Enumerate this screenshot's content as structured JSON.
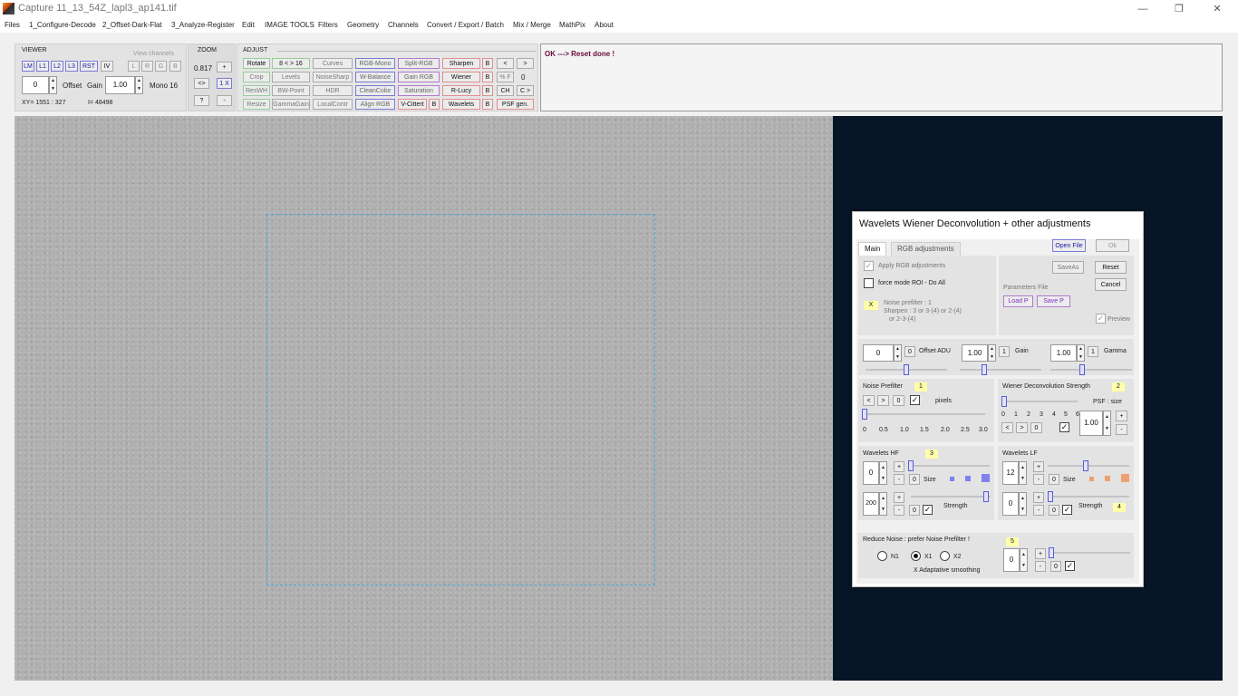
{
  "window": {
    "title": "Capture 11_13_54Z_lapl3_ap141.tif",
    "minimize": "—",
    "maximize": "❐",
    "close": "✕"
  },
  "menu": [
    "Files",
    "1_Configure-Decode",
    "2_Offset-Dark-Flat",
    "3_Analyze-Register",
    "Edit",
    "IMAGE TOOLS",
    "Filters",
    "Geometry",
    "Channels",
    "Convert / Export / Batch",
    "Mix / Merge",
    "MathPix",
    "About"
  ],
  "viewer": {
    "title": "VIEWER",
    "view_channels": "View channels",
    "buttons": [
      "LM",
      "L1",
      "L2",
      "L3",
      "RST",
      "IV"
    ],
    "channels": [
      "L",
      "R",
      "G",
      "B"
    ],
    "offset_value": "0",
    "offset_label": "Offset",
    "gain_label": "Gain",
    "gain_value": "1.00",
    "mono": "Mono 16",
    "xy": "XY=  1551 : 327",
    "intensity": "I=  48498"
  },
  "zoom": {
    "title": "ZOOM",
    "value": "0.817",
    "plus": "+",
    "fit": "<>",
    "one": "1 X",
    "help": "?",
    "minus": "-"
  },
  "adjust": {
    "title": "ADJUST",
    "rows": [
      [
        "Rotate",
        "8 < > 16",
        "Curves",
        "RGB-Mono",
        "Split-RGB",
        "Sharpen"
      ],
      [
        "Crop",
        "Levels",
        "NoiseSharp",
        "W-Balance",
        "Gain RGB",
        "Wiener"
      ],
      [
        "ResWH",
        "BW-Point",
        "HDR",
        "CleanColor",
        "Saturation",
        "R-Lucy"
      ],
      [
        "Resize",
        "GammaGain",
        "LocalContr",
        "Align RGB",
        "V-Cittert",
        "Wavelets"
      ]
    ],
    "b_label": "B",
    "nav_prev": "<",
    "nav_next": ">",
    "pct_f": "% F",
    "pct_value": "0",
    "ch": "CH",
    "c_next": "C >",
    "psf_gen": "PSF gen."
  },
  "status": {
    "message": "OK --->  Reset done !"
  },
  "dialog": {
    "title": "Wavelets Wiener Deconvolution + other adjustments",
    "tabs": [
      "Main",
      "RGB adjustments"
    ],
    "open_file": "Open File",
    "ok": "Ok",
    "apply_rgb": "Apply RGB adjustments",
    "force_mode": "force mode  ROI - Do All",
    "x_label": "X",
    "hint_1": "Noise prefilter :  1",
    "hint_2": "Sharpen :  3  or  3-(4)  or  2-(4)",
    "hint_3": "or  2-3-(4)",
    "save_as": "SaveAs",
    "reset": "Reset",
    "cancel": "Cancel",
    "params_file": "Parameters File",
    "load_p": "Load P",
    "save_p": "Save P",
    "preview": "Preview",
    "offset": {
      "value": "0",
      "zero": "0",
      "label": "Offset ADU",
      "level": 0.5
    },
    "gain": {
      "value": "1.00",
      "one": "1",
      "label": "Gain",
      "level": 0.28
    },
    "gamma": {
      "value": "1.00",
      "one": "1",
      "label": "Gamma",
      "level": 0.38
    },
    "noise_prefilter": {
      "label": "Noise Prefilter",
      "badge": "1",
      "prev": "<",
      "next": ">",
      "zero": "0",
      "unit": "pixels",
      "ticks": [
        "0",
        "0.5",
        "1.0",
        "1.5",
        "2.0",
        "2.5",
        "3.0"
      ],
      "level": 0.0
    },
    "wiener": {
      "label": "Wiener Deconvolution Strength",
      "badge": "2",
      "psf_label": "PSF : size",
      "ticks": [
        "0",
        "1",
        "2",
        "3",
        "4",
        "5",
        "6"
      ],
      "prev": "<",
      "next": ">",
      "zero": "0",
      "psf_value": "1.00",
      "plus": "+",
      "minus": "-",
      "level": 0.0
    },
    "wavelets_hf": {
      "label": "Wavelets HF",
      "badge": "3",
      "value": "0",
      "plus": "+",
      "minus": "-",
      "zero": "0",
      "size_label": "Size",
      "strength_value": "200",
      "strength_label": "Strength",
      "size_level": 0.0,
      "strength_level": 0.97,
      "color": "#8080ee"
    },
    "wavelets_lf": {
      "label": "Wavelets LF",
      "value": "12",
      "plus": "+",
      "minus": "-",
      "zero": "0",
      "size_label": "Size",
      "strength_value": "0",
      "strength_label": "Strength",
      "badge": "4",
      "size_level": 0.47,
      "strength_level": 0.0,
      "color": "#f0a070"
    },
    "reduce_noise": {
      "label": "Reduce Noise :  prefer Noise Prefilter !",
      "badge": "5",
      "options": [
        "N1",
        "X1",
        "X2"
      ],
      "selected": "X1",
      "adaptive": "X Adaptative smoothing",
      "value": "0",
      "plus": "+",
      "minus": "-",
      "zero": "0",
      "level": 0.0
    }
  }
}
